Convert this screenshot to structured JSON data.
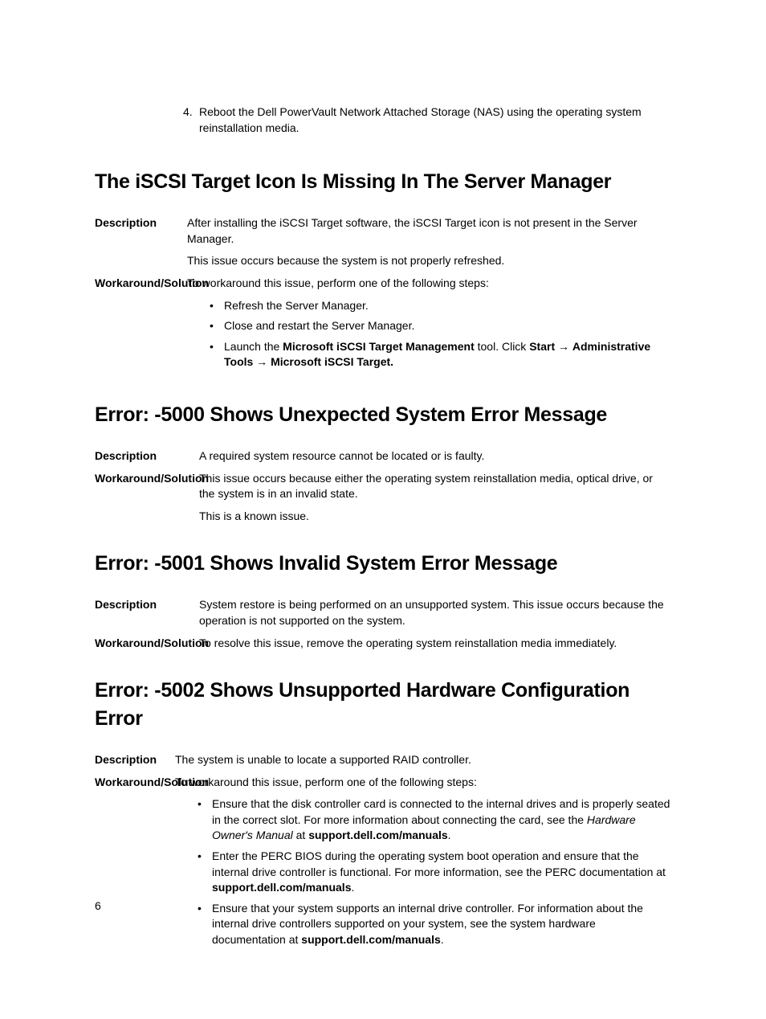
{
  "step4": {
    "num": "4.",
    "text": "Reboot the Dell PowerVault Network Attached Storage (NAS) using the operating system reinstallation media."
  },
  "sec1": {
    "heading": "The iSCSI Target Icon Is Missing In The Server Manager",
    "descLabel": "Description",
    "desc1": "After installing the iSCSI Target software, the iSCSI Target icon is not present in the Server Manager.",
    "desc2": "This issue occurs because the system is not properly refreshed.",
    "workLabel": "Workaround/Solution",
    "workIntro": "To workaround this issue, perform one of the following steps:",
    "bullets": {
      "b1": "Refresh the Server Manager.",
      "b2": "Close and restart the Server Manager.",
      "b3a": "Launch the ",
      "b3b": "Microsoft iSCSI Target Management",
      "b3c": " tool. Click ",
      "b3d": "Start",
      "b3e": " → ",
      "b3f": "Administrative Tools",
      "b3g": " → ",
      "b3h": "Microsoft iSCSI Target."
    }
  },
  "sec2": {
    "heading": "Error: -5000 Shows Unexpected System Error Message",
    "descLabel": "Description",
    "desc": "A required system resource cannot be located or is faulty.",
    "workLabel": "Workaround/Solution",
    "work1": "This issue occurs because either the operating system reinstallation media, optical drive, or the system is in an invalid state.",
    "work2": "This is a known issue."
  },
  "sec3": {
    "heading": "Error: -5001 Shows Invalid System Error Message",
    "descLabel": "Description",
    "desc": "System restore is being performed on an unsupported system. This issue occurs because the operation is not supported on the system.",
    "workLabel": "Workaround/Solution",
    "work": "To resolve this issue, remove the operating system reinstallation media immediately."
  },
  "sec4": {
    "heading": "Error: -5002 Shows Unsupported Hardware Configuration Error",
    "descLabel": "Description",
    "desc": "The system is unable to locate a supported RAID controller.",
    "workLabel": "Workaround/Solution",
    "workIntro": "To workaround this issue, perform one of the following steps:",
    "bullets": {
      "b1a": "Ensure that the disk controller card is connected to the internal drives and is properly seated in the correct slot. For more information about connecting the card, see the ",
      "b1b": "Hardware Owner's Manual",
      "b1c": " at ",
      "b1d": "support.dell.com/manuals",
      "b1e": ".",
      "b2a": "Enter the PERC BIOS during the operating system boot operation and ensure that the internal drive controller is functional. For more information, see the PERC documentation at ",
      "b2b": "support.dell.com/manuals",
      "b2c": ".",
      "b3a": "Ensure that your system supports an internal drive controller. For information about the internal drive controllers supported on your system, see the system hardware documentation at ",
      "b3b": "support.dell.com/manuals",
      "b3c": "."
    }
  },
  "pageNum": "6"
}
